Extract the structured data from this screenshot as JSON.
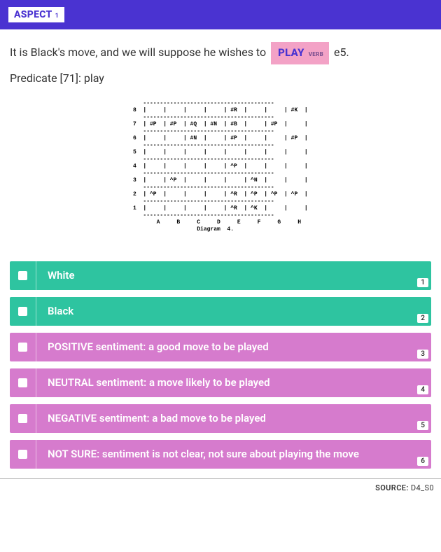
{
  "header": {
    "label": "ASPECT",
    "index": "1"
  },
  "sentence": {
    "pre": "It is Black's move, and we will suppose he wishes to ",
    "chip_main": "PLAY",
    "chip_pos": "VERB",
    "post": " e5."
  },
  "predicate": "Predicate [71]: play",
  "diagram": "   ---------------------------------------\n8  |     |     |     |     | #R  |     |     | #K  |\n   ---------------------------------------\n7  | #P  | #P  | #Q  | #N  | #B  |     | #P  |     |\n   ---------------------------------------\n6  |     |     | #N  |     | #P  |     |     | #P  |\n   ---------------------------------------\n5  |     |     |     |     |     |     |     |     |\n   ---------------------------------------\n4  |     |     |     |     | ^P  |     |     |     |\n   ---------------------------------------\n3  |     | ^P  |     |     |     | ^N  |     |     |\n   ---------------------------------------\n2  | ^P  |     |     |     | ^R  | ^P  | ^P  | ^P  |\n   ---------------------------------------\n1  |     |     |     |     | ^R  | ^K  |     |     |\n   ---------------------------------------\n       A     B     C     D     E     F     G     H\n                   Diagram  4.",
  "options": [
    {
      "text": "White",
      "num": "1",
      "color": "green"
    },
    {
      "text": "Black",
      "num": "2",
      "color": "green"
    },
    {
      "text": "POSITIVE sentiment: a good move to be played",
      "num": "3",
      "color": "pink"
    },
    {
      "text": "NEUTRAL sentiment: a move likely to be played",
      "num": "4",
      "color": "pink"
    },
    {
      "text": "NEGATIVE sentiment: a bad move to be played",
      "num": "5",
      "color": "pink"
    },
    {
      "text": "NOT SURE: sentiment is not clear, not sure about playing the move",
      "num": "6",
      "color": "pink"
    }
  ],
  "footer": {
    "label": "SOURCE:",
    "value": "D4_S0"
  }
}
